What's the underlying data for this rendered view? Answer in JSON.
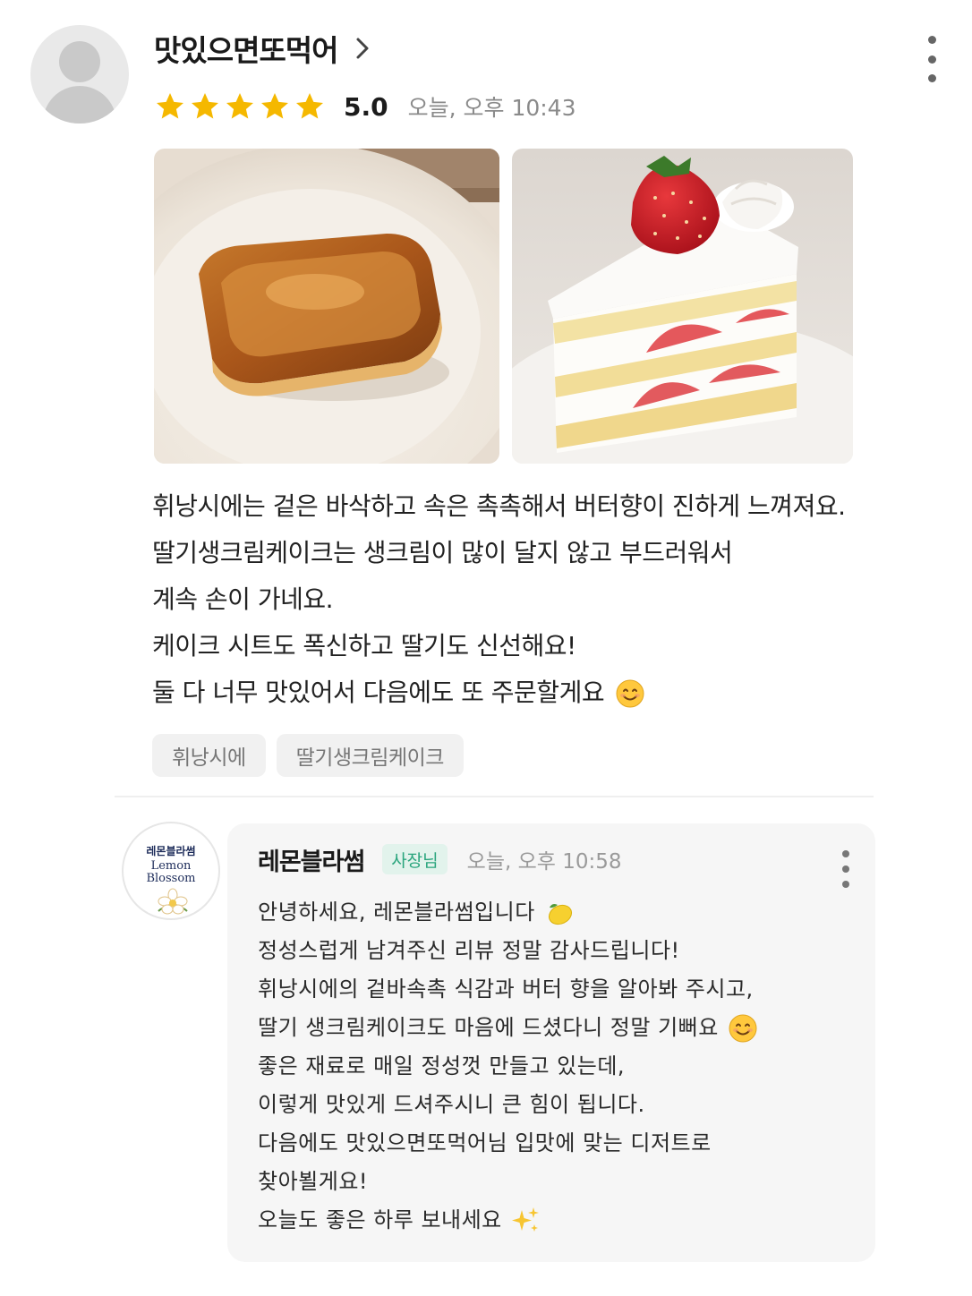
{
  "review": {
    "nickname": "맛있으면또먹어",
    "rating": 5,
    "rating_text": "5.0",
    "date": "오늘, 오후 10:43",
    "photos": [
      "financier-photo",
      "strawberry-cake-photo"
    ],
    "text_lines": [
      "휘낭시에는 겉은 바삭하고 속은 촉촉해서 버터향이 진하게 느껴져요.",
      "딸기생크림케이크는 생크림이 많이 달지 않고 부드러워서",
      "계속 손이 가네요.",
      "케이크 시트도 폭신하고 딸기도 신선해요!",
      "둘 다 너무 맛있어서 다음에도 또 주문할게요"
    ],
    "tags": [
      "휘낭시에",
      "딸기생크림케이크"
    ]
  },
  "reply": {
    "logo": {
      "ko": "레몬블라썸",
      "en1": "Lemon",
      "en2": "Blossom"
    },
    "owner_name": "레몬블라썸",
    "badge": "사장님",
    "date": "오늘, 오후 10:58",
    "text_lines": [
      "안녕하세요, 레몬블라썸입니다",
      "정성스럽게 남겨주신 리뷰 정말 감사드립니다!",
      "휘낭시에의 겉바속촉 식감과 버터 향을 알아봐 주시고,",
      "딸기 생크림케이크도 마음에 드셨다니 정말 기뻐요",
      "좋은 재료로 매일 정성껏 만들고 있는데,",
      "이렇게 맛있게 드셔주시니 큰 힘이 됩니다.",
      "다음에도 맛있으면또먹어님 입맛에 맞는 디저트로",
      "찾아뵐게요!",
      "오늘도 좋은 하루 보내세요"
    ]
  },
  "colors": {
    "star": "#F5B800",
    "badge_bg": "#E2F3EC",
    "badge_text": "#2AA57D"
  }
}
